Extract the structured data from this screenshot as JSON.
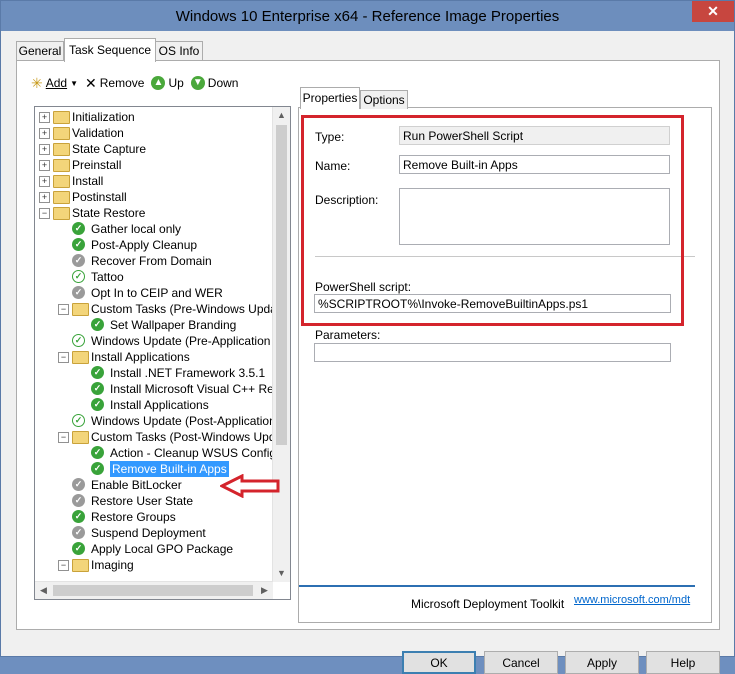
{
  "window": {
    "title": "Windows 10 Enterprise x64 - Reference Image Properties",
    "close_label": "✕"
  },
  "tabs": [
    {
      "label": "General"
    },
    {
      "label": "Task Sequence"
    },
    {
      "label": "OS Info"
    }
  ],
  "toolbar": {
    "add": "Add",
    "remove": "Remove",
    "up": "Up",
    "down": "Down"
  },
  "tree": [
    {
      "label": "Initialization",
      "kind": "group",
      "expanded": false
    },
    {
      "label": "Validation",
      "kind": "group",
      "expanded": false
    },
    {
      "label": "State Capture",
      "kind": "group",
      "expanded": false
    },
    {
      "label": "Preinstall",
      "kind": "group",
      "expanded": false
    },
    {
      "label": "Install",
      "kind": "group",
      "expanded": false
    },
    {
      "label": "Postinstall",
      "kind": "group",
      "expanded": false
    },
    {
      "label": "State Restore",
      "kind": "group",
      "expanded": true
    },
    {
      "label": "Gather local only",
      "kind": "step"
    },
    {
      "label": "Post-Apply Cleanup",
      "kind": "step"
    },
    {
      "label": "Recover From Domain",
      "kind": "step-disabled"
    },
    {
      "label": "Tattoo",
      "kind": "step-hollow"
    },
    {
      "label": "Opt In to CEIP and WER",
      "kind": "step-disabled"
    },
    {
      "label": "Custom Tasks (Pre-Windows Update)",
      "kind": "group",
      "expanded": true
    },
    {
      "label": "Set Wallpaper Branding",
      "kind": "step"
    },
    {
      "label": "Windows Update (Pre-Application Inst",
      "kind": "step-hollow"
    },
    {
      "label": "Install Applications",
      "kind": "group",
      "expanded": true
    },
    {
      "label": "Install .NET Framework 3.5.1",
      "kind": "step"
    },
    {
      "label": "Install Microsoft Visual C++ Redist",
      "kind": "step"
    },
    {
      "label": "Install Applications",
      "kind": "step"
    },
    {
      "label": "Windows Update (Post-Application Ins",
      "kind": "step-hollow"
    },
    {
      "label": "Custom Tasks (Post-Windows Update",
      "kind": "group",
      "expanded": true
    },
    {
      "label": "Action - Cleanup WSUS Configura",
      "kind": "step"
    },
    {
      "label": "Remove Built-in Apps",
      "kind": "step",
      "selected": true
    },
    {
      "label": "Enable BitLocker",
      "kind": "step-disabled"
    },
    {
      "label": "Restore User State",
      "kind": "step-disabled"
    },
    {
      "label": "Restore Groups",
      "kind": "step"
    },
    {
      "label": "Suspend Deployment",
      "kind": "step-disabled"
    },
    {
      "label": "Apply Local GPO Package",
      "kind": "step"
    },
    {
      "label": "Imaging",
      "kind": "group",
      "expanded": true
    }
  ],
  "props": {
    "tabs": [
      {
        "label": "Properties"
      },
      {
        "label": "Options"
      }
    ],
    "type_label": "Type:",
    "type_value": "Run PowerShell Script",
    "name_label": "Name:",
    "name_value": "Remove Built-in Apps",
    "description_label": "Description:",
    "description_value": "",
    "script_label": "PowerShell script:",
    "script_value": "%SCRIPTROOT%\\Invoke-RemoveBuiltinApps.ps1",
    "parameters_label": "Parameters:",
    "parameters_value": "",
    "footer_brand": "Microsoft Deployment Toolkit",
    "footer_link": "www.microsoft.com/mdt"
  },
  "buttons": {
    "ok": "OK",
    "cancel": "Cancel",
    "apply": "Apply",
    "help": "Help"
  },
  "colors": {
    "highlight": "#d4242c",
    "selection": "#3399ff",
    "annotation_arrow": "#d4242c"
  }
}
